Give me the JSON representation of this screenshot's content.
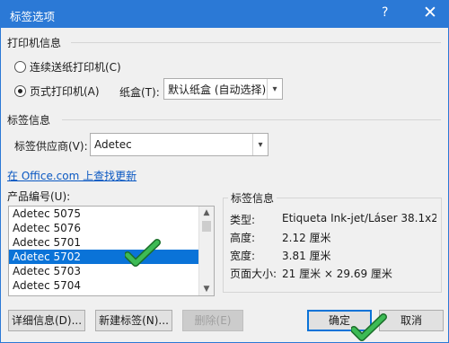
{
  "window": {
    "title": "标签选项",
    "help": "?",
    "close": "✕"
  },
  "printer_info": {
    "heading": "打印机信息",
    "continuous_label": "连续送纸打印机(C)",
    "page_label": "页式打印机(A)",
    "tray_label": "纸盒(T):",
    "tray_value": "默认纸盒 (自动选择)",
    "selected": "page"
  },
  "label_info": {
    "heading": "标签信息",
    "vendor_label": "标签供应商(V):",
    "vendor_value": "Adetec",
    "update_link": "在 Office.com 上查找更新",
    "product_label": "产品编号(U):",
    "products": [
      "Adetec 5075",
      "Adetec 5076",
      "Adetec 5701",
      "Adetec 5702",
      "Adetec 5703",
      "Adetec 5704"
    ],
    "selected_product": "Adetec 5702"
  },
  "details": {
    "heading": "标签信息",
    "rows": [
      {
        "key": "类型:",
        "value": "Etiqueta Ink-jet/Láser 38.1x2..."
      },
      {
        "key": "高度:",
        "value": "2.12 厘米"
      },
      {
        "key": "宽度:",
        "value": "3.81 厘米"
      },
      {
        "key": "页面大小:",
        "value": "21 厘米 × 29.69 厘米"
      }
    ]
  },
  "buttons": {
    "details": "详细信息(D)...",
    "new_label": "新建标签(N)...",
    "delete": "删除(E)",
    "ok": "确定",
    "cancel": "取消"
  },
  "colors": {
    "titlebar": "#2b79d6",
    "selection": "#0a73d8",
    "checkmark": "#2ea043"
  },
  "icons": {
    "annotation": "green-checkmark-icon"
  }
}
